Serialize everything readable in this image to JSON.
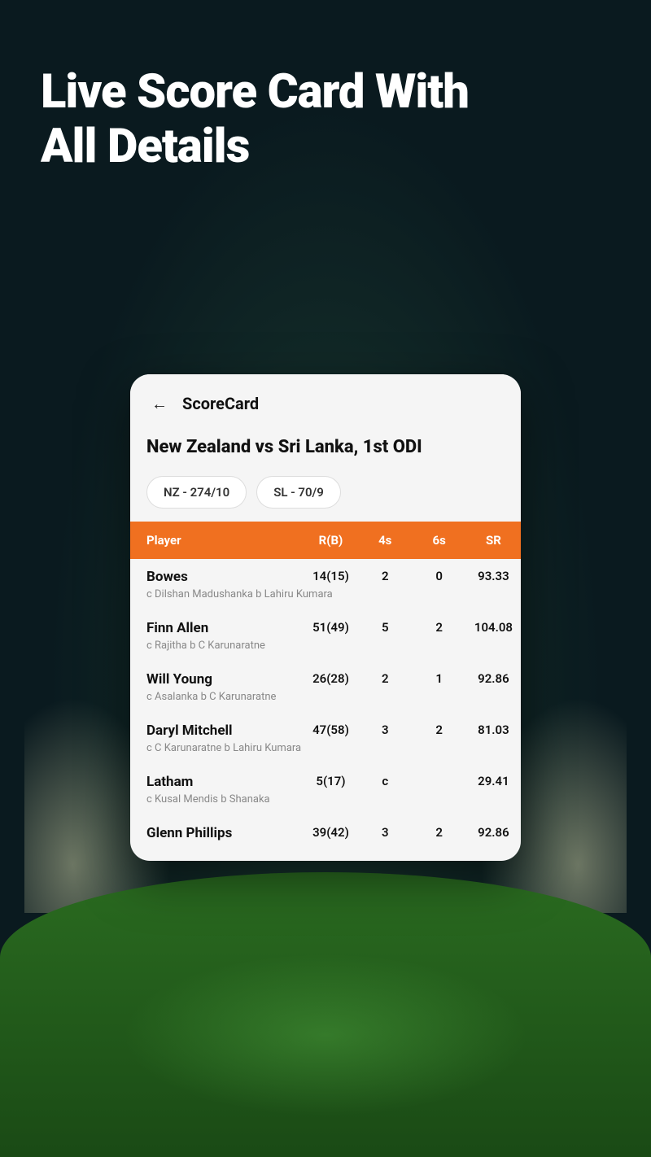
{
  "headline": {
    "line1": "Live Score Card With",
    "line2": "All Details"
  },
  "card": {
    "back_label": "←",
    "title": "ScoreCard",
    "match_title": "New Zealand vs Sri Lanka, 1st ODI",
    "scores": [
      {
        "id": "nz",
        "label": "NZ - 274/10"
      },
      {
        "id": "sl",
        "label": "SL - 70/9"
      }
    ],
    "table": {
      "headers": [
        "Player",
        "R(B)",
        "4s",
        "6s",
        "SR"
      ],
      "players": [
        {
          "name": "Bowes",
          "rb": "14(15)",
          "fours": "2",
          "sixes": "0",
          "sr": "93.33",
          "dismissal": "c Dilshan Madushanka b Lahiru Kumara"
        },
        {
          "name": "Finn Allen",
          "rb": "51(49)",
          "fours": "5",
          "sixes": "2",
          "sr": "104.08",
          "dismissal": "c Rajitha b C Karunaratne"
        },
        {
          "name": "Will Young",
          "rb": "26(28)",
          "fours": "2",
          "sixes": "1",
          "sr": "92.86",
          "dismissal": "c Asalanka b C Karunaratne"
        },
        {
          "name": "Daryl Mitchell",
          "rb": "47(58)",
          "fours": "3",
          "sixes": "2",
          "sr": "81.03",
          "dismissal": "c C Karunaratne b Lahiru Kumara"
        },
        {
          "name": "Latham",
          "rb": "5(17)",
          "fours": "c",
          "sixes": "",
          "sr": "29.41",
          "dismissal": "c Kusal Mendis b Shanaka"
        },
        {
          "name": "Glenn Phillips",
          "rb": "39(42)",
          "fours": "3",
          "sixes": "2",
          "sr": "92.86",
          "dismissal": ""
        }
      ]
    }
  }
}
